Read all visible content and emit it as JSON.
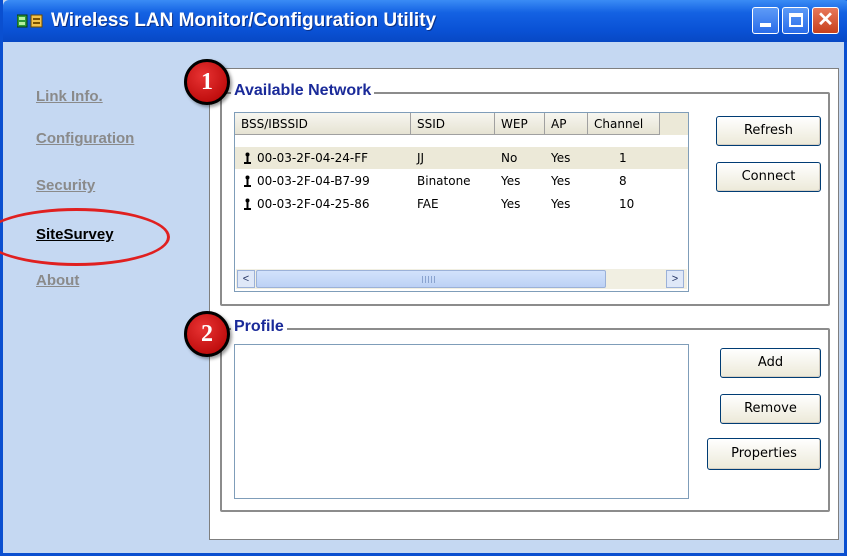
{
  "window": {
    "title": "Wireless LAN Monitor/Configuration Utility",
    "icons": {
      "app": "app-network-icon",
      "min": "minimize-icon",
      "max": "maximize-icon",
      "close": "close-icon"
    },
    "close_glyph": "✕"
  },
  "nav": {
    "items": [
      {
        "label": "Link Info.",
        "active": false
      },
      {
        "label": "Configuration",
        "active": false
      },
      {
        "label": "Security",
        "active": false
      },
      {
        "label": "SiteSurvey",
        "active": true
      },
      {
        "label": "About",
        "active": false
      }
    ]
  },
  "annotations": {
    "badge1": "1",
    "badge2": "2",
    "highlight_color": "#e02020"
  },
  "available_network": {
    "title": "Available Network",
    "columns": [
      "BSS/IBSSID",
      "SSID",
      "WEP",
      "AP",
      "Channel"
    ],
    "rows": [
      {
        "bssid": "00-03-2F-04-24-FF",
        "ssid": "JJ",
        "wep": "No",
        "ap": "Yes",
        "channel": "1",
        "selected": true
      },
      {
        "bssid": "00-03-2F-04-B7-99",
        "ssid": "Binatone",
        "wep": "Yes",
        "ap": "Yes",
        "channel": "8",
        "selected": false
      },
      {
        "bssid": "00-03-2F-04-25-86",
        "ssid": "FAE",
        "wep": "Yes",
        "ap": "Yes",
        "channel": "10",
        "selected": false
      }
    ],
    "row_icon": "station-antenna-icon",
    "scroll_left": "<",
    "scroll_right": ">",
    "buttons": {
      "refresh": "Refresh",
      "connect": "Connect"
    }
  },
  "profile": {
    "title": "Profile",
    "buttons": {
      "add": "Add",
      "remove": "Remove",
      "properties": "Properties"
    }
  },
  "colors": {
    "titlebar": "#0a52d6",
    "sidebar": "#c5d8f2",
    "group_title": "#1a2a99",
    "badge": "#c00000"
  }
}
